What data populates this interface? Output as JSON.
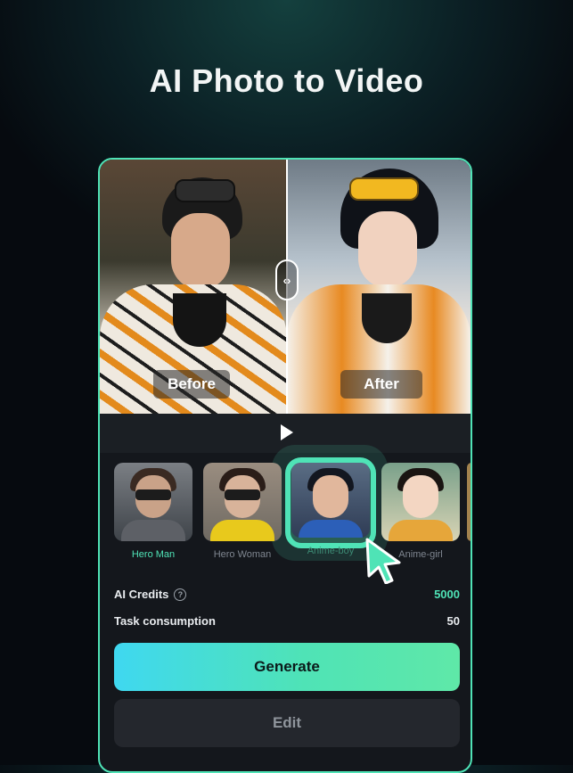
{
  "headline": "AI Photo to Video",
  "compare": {
    "before_label": "Before",
    "after_label": "After"
  },
  "styles": [
    {
      "label": "Hero Man",
      "active": true
    },
    {
      "label": "Hero Woman",
      "active": false
    },
    {
      "label": "Anime-boy",
      "active": false,
      "selected": true
    },
    {
      "label": "Anime-girl",
      "active": false
    }
  ],
  "credits": {
    "label": "AI Credits",
    "value": "5000"
  },
  "task": {
    "label": "Task consumption",
    "value": "50"
  },
  "buttons": {
    "generate": "Generate",
    "edit": "Edit"
  },
  "colors": {
    "accent": "#4fe3b6",
    "gradient_start": "#3fd8f0"
  },
  "icons": {
    "play": "play-icon",
    "handle": "compare-handle-icon",
    "info": "info-icon",
    "cursor": "pointer-cursor-icon"
  }
}
